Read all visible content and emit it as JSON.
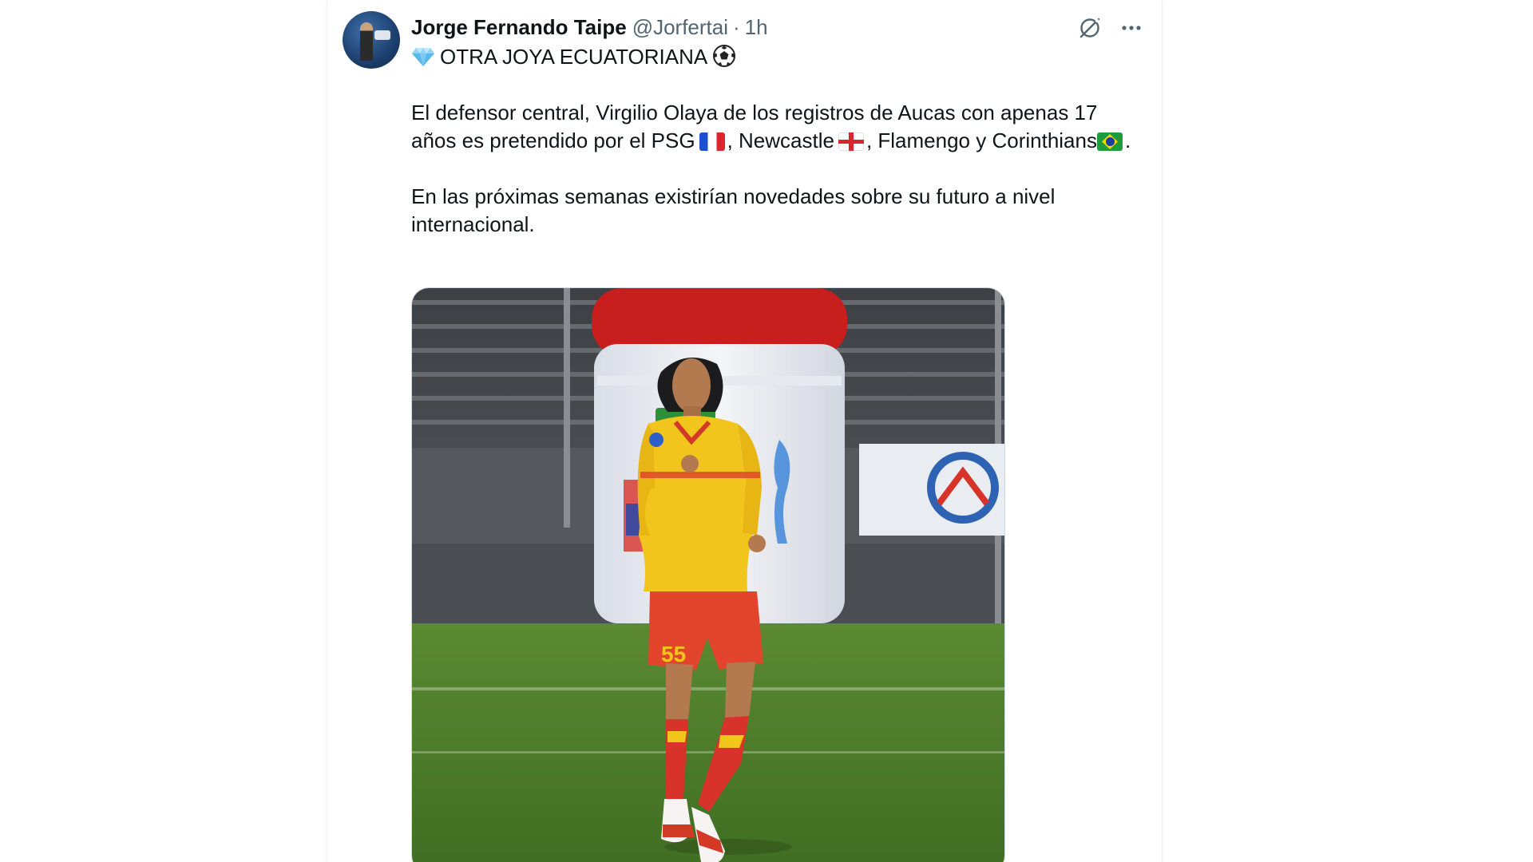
{
  "tweet": {
    "author_name": "Jorge Fernando Taipe",
    "author_handle": "@Jorfertai",
    "separator": "·",
    "timestamp": "1h",
    "headline": "OTRA JOYA ECUATORIANA",
    "paragraph1_part1": "El defensor central, Virgilio Olaya de los registros de Aucas con apenas 17 años es pretendido por el PSG",
    "paragraph1_part2": ", Newcastle",
    "paragraph1_part3": ", Flamengo y Corinthians",
    "paragraph1_part4": ".",
    "paragraph2": "En las próximas semanas existirían novedades sobre su futuro a nivel internacional."
  },
  "icons": {
    "headline_lead": "gem-icon",
    "headline_trail": "soccer-ball-icon",
    "flags": [
      "flag-france-icon",
      "flag-england-icon",
      "flag-brazil-icon"
    ],
    "actions": [
      "grok-icon",
      "more-icon"
    ]
  },
  "colors": {
    "text_primary": "#0f1419",
    "text_secondary": "#536471",
    "jersey_yellow": "#f2c51d",
    "shorts_red": "#e2452c"
  }
}
